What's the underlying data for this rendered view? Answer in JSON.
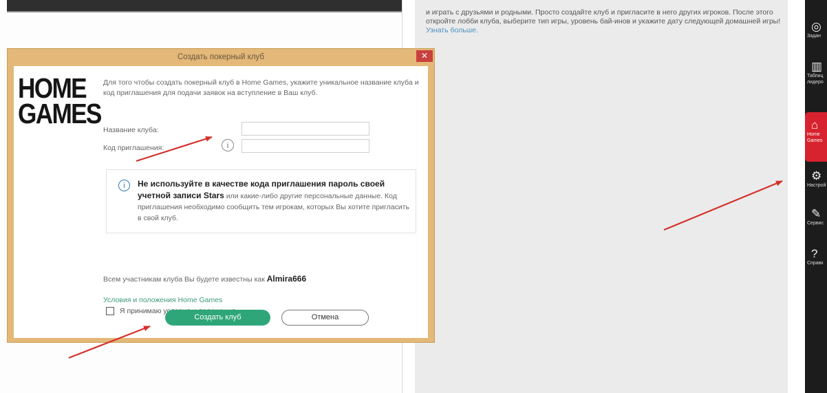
{
  "background": {
    "content_text_part1": "и играть с друзьями и родными. Просто создайте клуб и пригласите в него других игроков. После этого откройте лобби клуба, выберите тип игры, уровень бай-инов и укажите дату следующей домашней игры!",
    "content_link": "Узнать больше."
  },
  "sidebar": {
    "items": [
      {
        "label": "Задан",
        "icon": "target-icon"
      },
      {
        "label": "Таблиц лидеро",
        "icon": "leaderboard-icon"
      },
      {
        "label": "Home Games",
        "icon": "home-icon"
      },
      {
        "label": "Настрой",
        "icon": "gear-icon"
      },
      {
        "label": "Сервис",
        "icon": "wrench-icon"
      },
      {
        "label": "Справк",
        "icon": "help-icon"
      }
    ],
    "active_color": "#d7232f"
  },
  "dialog": {
    "title": "Создать покерный клуб",
    "close_symbol": "✕",
    "logo_line1": "HOME",
    "logo_line2": "GAMES",
    "intro": "Для того чтобы создать покерный клуб в Home Games, укажите уникальное название клуба и код приглашения для подачи заявок на вступление в Ваш клуб.",
    "club_name_label": "Название клуба:",
    "club_name_value": "",
    "invite_code_label": "Код приглашения:",
    "invite_code_value": "",
    "info_symbol": "i",
    "warning_bold": "Не используйте в качестве кода приглашения пароль своей учетной записи Stars",
    "warning_rest": " или какие-либо другие персональные данные. Код приглашения необходимо сообщить тем игрокам, которых Вы хотите пригласить в свой клуб.",
    "known_as_text": "Всем участникам клуба Вы будете известны как ",
    "username": "Almira666",
    "terms_link": "Условия и положения Home Games",
    "accept_label": "Я принимаю условия и положения",
    "accept_checked": false,
    "create_button": "Создать клуб",
    "cancel_button": "Отмена",
    "accent_color": "#2ea67a",
    "frame_color": "#e3b878"
  },
  "annotations": {
    "arrow_color": "#d3312b"
  }
}
